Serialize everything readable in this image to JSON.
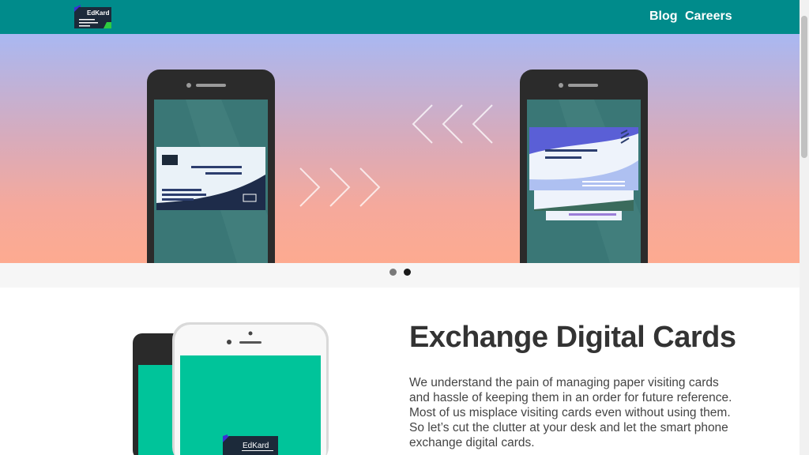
{
  "navbar": {
    "logo_text": "EdKard",
    "links": [
      {
        "label": "Blog"
      },
      {
        "label": "Careers"
      }
    ]
  },
  "carousel": {
    "slides_count": 2,
    "active_index": 1
  },
  "content": {
    "title": "Exchange Digital Cards",
    "body": "We understand the pain of managing paper visiting cards and hassle of keeping them in an order for future reference. Most of us misplace visiting cards even without using them. So let’s cut the clutter at your desk and let the smart phone exchange digital cards.",
    "phone_logo_text": "EdKard"
  },
  "colors": {
    "nav_bg": "#008b8b",
    "phone_screen_teal": "#00c49a"
  }
}
